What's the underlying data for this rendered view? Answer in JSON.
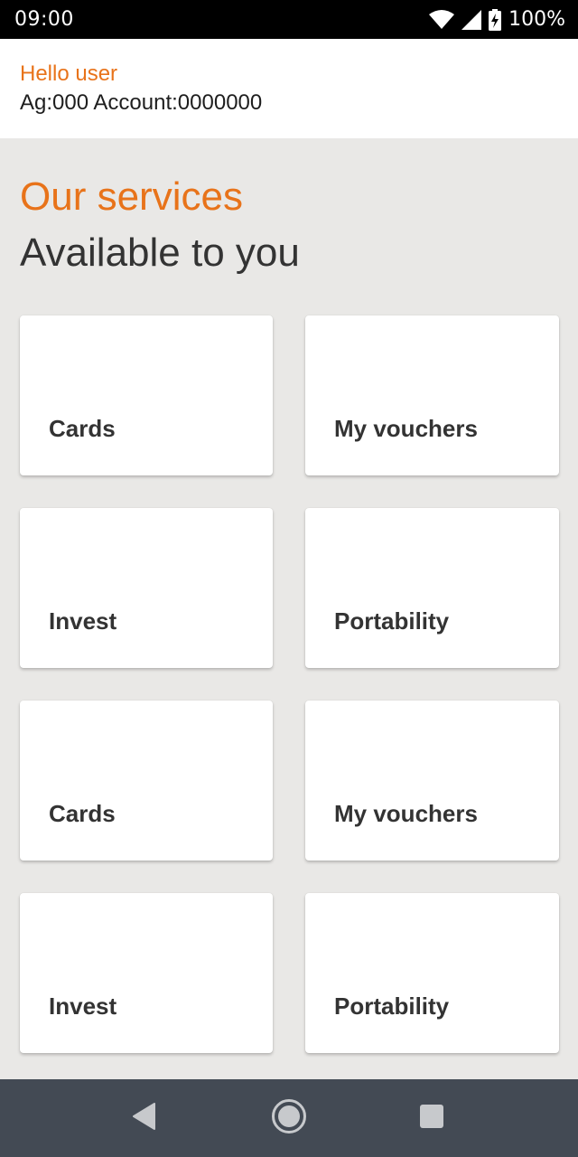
{
  "status_bar": {
    "time": "09:00",
    "battery": "100%",
    "icons": [
      "wifi-icon",
      "signal-icon",
      "battery-charging-icon"
    ]
  },
  "header": {
    "greeting": "Hello user",
    "account": "Ag:000 Account:0000000"
  },
  "section": {
    "title": "Our services",
    "subtitle": "Available to you"
  },
  "services": [
    {
      "label": "Cards"
    },
    {
      "label": "My vouchers"
    },
    {
      "label": "Invest"
    },
    {
      "label": "Portability"
    },
    {
      "label": "Cards"
    },
    {
      "label": "My vouchers"
    },
    {
      "label": "Invest"
    },
    {
      "label": "Portability"
    }
  ],
  "nav_bar": {
    "icons": [
      "back-icon",
      "home-icon",
      "recents-icon"
    ]
  },
  "colors": {
    "accent": "#e8731a",
    "background": "#e9e8e6",
    "nav_bar": "#434a54"
  }
}
